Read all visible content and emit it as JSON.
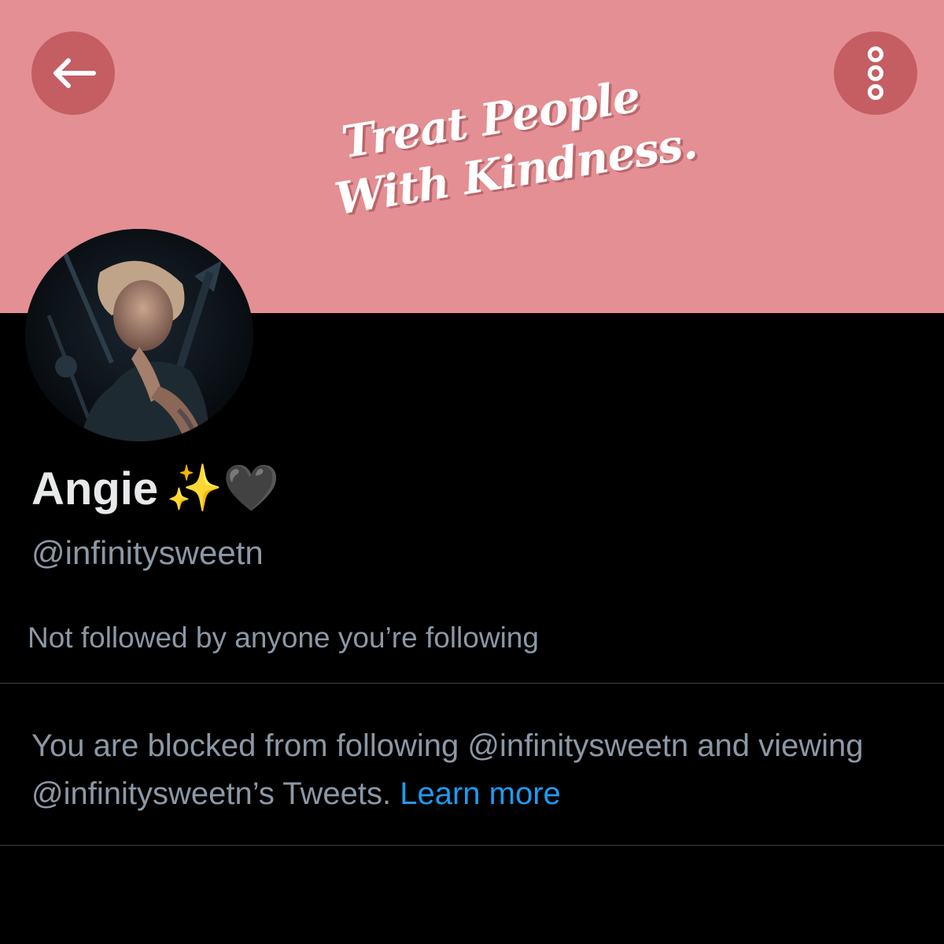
{
  "header": {
    "back_icon": "arrow-left-icon",
    "more_icon": "more-vertical-icon",
    "button_color": "#c45e63"
  },
  "banner": {
    "background_color": "#e48f93",
    "logo_line1": "Treat People",
    "logo_line2": "With Kindness."
  },
  "profile": {
    "display_name": "Angie",
    "name_emoji": "✨🖤",
    "handle": "@infinitysweetn",
    "followed_by_text": "Not followed by anyone you’re following"
  },
  "blocked": {
    "message": "You are blocked from following @infinitysweetn and viewing @infinitysweetn’s Tweets.",
    "learn_more": "Learn more",
    "link_color": "#1d9bf0"
  }
}
